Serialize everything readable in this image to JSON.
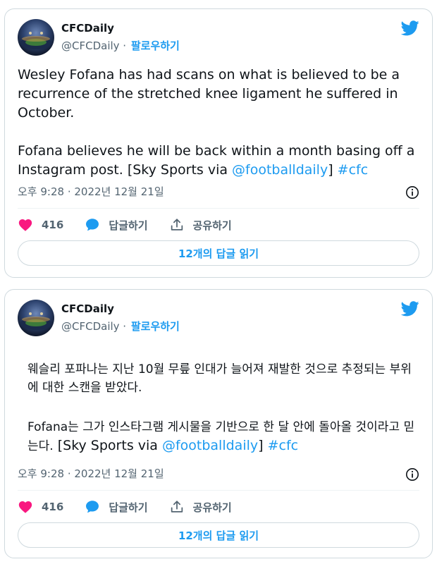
{
  "tweets": [
    {
      "author": {
        "name": "CFCDaily",
        "handle": "@CFCDaily",
        "separator": " · ",
        "follow_label": "팔로우하기"
      },
      "body": {
        "p1": "Wesley Fofana has had scans on what is believed to be a recurrence of the stretched knee ligament he suffered in October.",
        "p2_text": "Fofana believes he will be back within a month basing off a Instagram post.  [Sky Sports via ",
        "mention": "@footballdaily",
        "p2_close": "] ",
        "hashtag": "#cfc"
      },
      "timestamp": "오후 9:28 · 2022년 12월 21일",
      "like_count": "416",
      "reply_label": "답글하기",
      "share_label": "공유하기",
      "read_replies_label": "12개의 답글 읽기"
    },
    {
      "author": {
        "name": "CFCDaily",
        "handle": "@CFCDaily",
        "separator": " · ",
        "follow_label": "팔로우하기"
      },
      "body": {
        "p1": "웨슬리 포파나는 지난 10월 무릎 인대가 늘어져 재발한 것으로 추정되는 부위에 대한 스캔을 받았다.",
        "p2_text": "Fofana는 그가 인스타그램 게시물을 기반으로 한 달 안에 돌아올 것이라고 믿는다.",
        "source_text": "  [Sky Sports via ",
        "mention": "@footballdaily",
        "p2_close": "] ",
        "hashtag": "#cfc"
      },
      "timestamp": "오후 9:28 · 2022년 12월 21일",
      "like_count": "416",
      "reply_label": "답글하기",
      "share_label": "공유하기",
      "read_replies_label": "12개의 답글 읽기"
    }
  ],
  "colors": {
    "accent": "#1d9bf0",
    "like": "#f91880",
    "text": "#0f1419",
    "muted": "#536471",
    "border": "#cfd9de"
  },
  "icons": [
    "twitter-bird-icon",
    "info-icon",
    "heart-icon",
    "reply-bubble-icon",
    "share-upload-icon"
  ]
}
